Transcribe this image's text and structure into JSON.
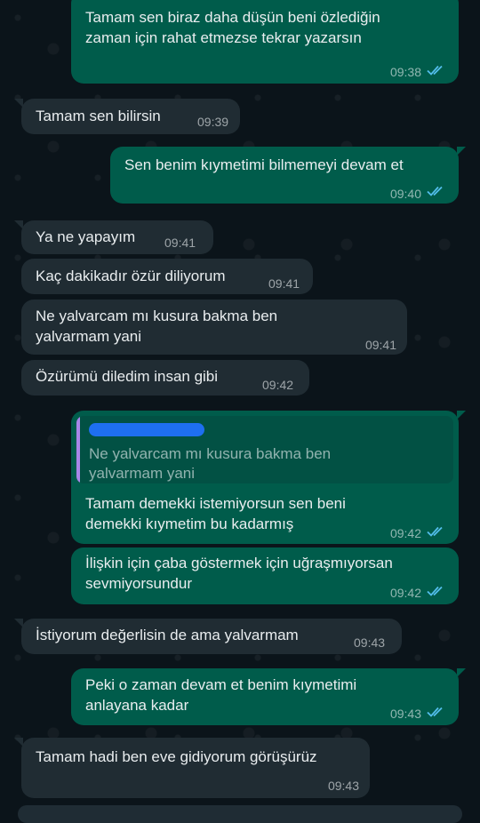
{
  "messages": [
    {
      "dir": "out",
      "text": "Tamam sen biraz daha düşün beni özlediğin\nzaman için rahat etmezse tekrar yazarsın",
      "time": "09:38"
    },
    {
      "dir": "in",
      "text": "Tamam sen bilirsin",
      "time": "09:39"
    },
    {
      "dir": "out",
      "text": "Sen benim kıymetimi bilmemeyi devam et",
      "time": "09:40"
    },
    {
      "dir": "in",
      "text": "Ya ne yapayım",
      "time": "09:41"
    },
    {
      "dir": "in",
      "text": "Kaç dakikadır özür diliyorum",
      "time": "09:41"
    },
    {
      "dir": "in",
      "text": "Ne yalvarcam mı kusura bakma ben\nyalvarmam yani",
      "time": "09:41"
    },
    {
      "dir": "in",
      "text": "Özürümü diledim insan gibi",
      "time": "09:42"
    },
    {
      "dir": "out",
      "quote": "Ne yalvarcam mı kusura bakma ben\nyalvarmam yani",
      "text": "Tamam demekki istemiyorsun sen beni\ndemekki kıymetim bu kadarmış",
      "time": "09:42"
    },
    {
      "dir": "out",
      "text": "İlişkin için çaba göstermek için uğraşmıyorsan\nsevmiyorsundur",
      "time": "09:42"
    },
    {
      "dir": "in",
      "text": "İstiyorum değerlisin de ama yalvarmam",
      "time": "09:43"
    },
    {
      "dir": "out",
      "text": "Peki o zaman devam et benim kıymetimi\nanlayana kadar",
      "time": "09:43"
    },
    {
      "dir": "in",
      "text": "Tamam hadi ben eve gidiyorum görüşürüz",
      "time": "09:43"
    }
  ],
  "colors": {
    "incoming": "#202c33",
    "outgoing": "#005c4b",
    "read_ticks": "#53bdeb"
  }
}
